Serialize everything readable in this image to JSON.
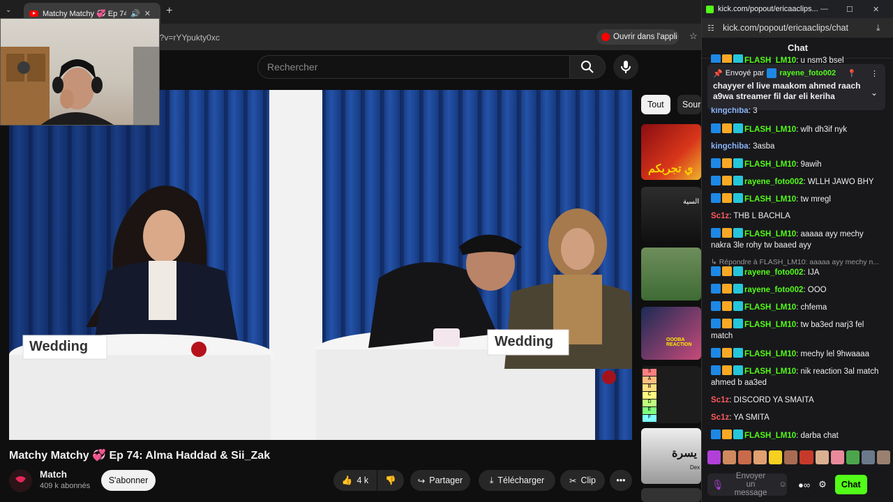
{
  "browser": {
    "tab_title": "Matchy Matchy 💞 Ep 74: A",
    "url_fragment": "n?v=rYYpukty0xc",
    "open_in_app": "Ouvrir dans l'appli"
  },
  "youtube": {
    "search_placeholder": "Rechercher",
    "video_title": "Matchy Matchy 💞 Ep 74: Alma Haddad & Sii_Zak",
    "channel_name": "Match",
    "subscribers": "409 k abonnés",
    "subscribe_label": "S'abonner",
    "likes": "4 k",
    "share_label": "Partager",
    "download_label": "Télécharger",
    "clip_label": "Clip",
    "chips": [
      "Tout",
      "Sour"
    ],
    "scene_signs": [
      "Wedding",
      "Wedding"
    ],
    "thumb_texts": [
      "ي تجربكم",
      "السية",
      "يسرة",
      "OOOBA REACTION",
      "Dex"
    ]
  },
  "kick": {
    "window_title": "kick.com/popout/ericaaclips...",
    "address": "kick.com/popout/ericaaclips/chat",
    "chat_header": "Chat",
    "pinned": {
      "sent_by_label": "Envoyé par",
      "sender": "rayene_foto002",
      "text": "chayyer el live maakom ahmed raach a9wa streamer fil dar eli keriha"
    },
    "partial_top": {
      "user": "FLASH_LM10",
      "text": "u nsm3 bsel"
    },
    "partial_under_pin": {
      "user": "kingchiba",
      "text": "3"
    },
    "reply_line": "Répondre à FLASH_LM10: aaaaa ayy mechy n...",
    "messages": [
      {
        "user": "FLASH_LM10",
        "text": "wlh dh3if nyk",
        "color": "#53fc18",
        "badges": true
      },
      {
        "user": "kingchiba",
        "text": "3asba",
        "color": "#8ab4f8",
        "badges": false
      },
      {
        "user": "FLASH_LM10",
        "text": "9awih",
        "color": "#53fc18",
        "badges": true
      },
      {
        "user": "rayene_foto002",
        "text": "WLLH JAWO BHY",
        "color": "#53fc18",
        "badges": true
      },
      {
        "user": "FLASH_LM10",
        "text": "tw mregl",
        "color": "#53fc18",
        "badges": true
      },
      {
        "user": "Sc1z",
        "text": "THB L BACHLA",
        "color": "#ff5a5a",
        "badges": false
      },
      {
        "user": "FLASH_LM10",
        "text": "aaaaa ayy mechy nakra 3le rohy tw baaed ayy",
        "color": "#53fc18",
        "badges": true
      },
      {
        "user": "rayene_foto002",
        "text": "IJA",
        "color": "#53fc18",
        "badges": true
      },
      {
        "user": "rayene_foto002",
        "text": "OOO",
        "color": "#53fc18",
        "badges": true
      },
      {
        "user": "FLASH_LM10",
        "text": "chfema",
        "color": "#53fc18",
        "badges": true
      },
      {
        "user": "FLASH_LM10",
        "text": "tw ba3ed narj3 fel match",
        "color": "#53fc18",
        "badges": true
      },
      {
        "user": "FLASH_LM10",
        "text": "mechy lel 9hwaaaa",
        "color": "#53fc18",
        "badges": true
      },
      {
        "user": "FLASH_LM10",
        "text": "nik reaction 3al match ahmed b aa3ed",
        "color": "#53fc18",
        "badges": true
      },
      {
        "user": "Sc1z",
        "text": "DISCORD YA SMAITA",
        "color": "#ff5a5a",
        "badges": false
      },
      {
        "user": "Sc1z",
        "text": "YA SMITA",
        "color": "#ff5a5a",
        "badges": false
      },
      {
        "user": "FLASH_LM10",
        "text": "darba chat",
        "color": "#53fc18",
        "badges": true
      }
    ],
    "input_placeholder": "Envoyer un message",
    "chat_button": "Chat"
  },
  "tier_letters": [
    "S",
    "A",
    "B",
    "C",
    "D",
    "E",
    "F"
  ],
  "colors": {
    "kick_green": "#53fc18",
    "yt_red": "#ff0000"
  }
}
